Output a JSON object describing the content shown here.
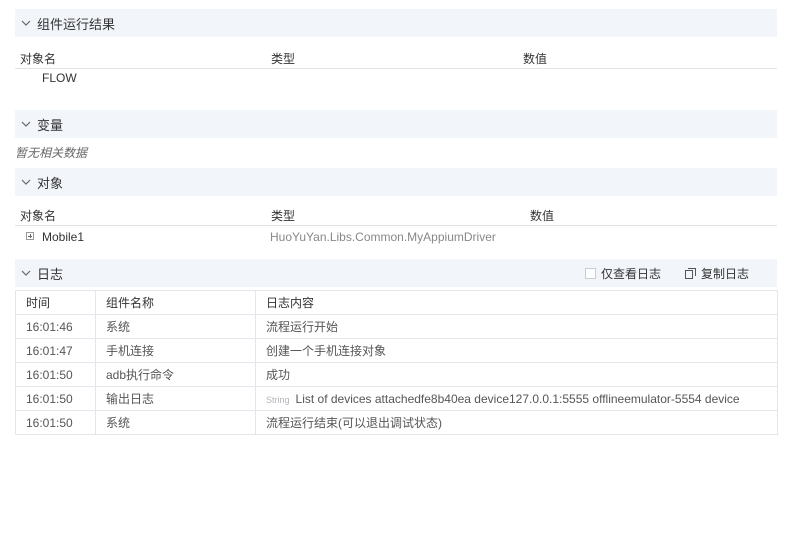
{
  "sections": {
    "results": {
      "title": "组件运行结果",
      "columns": [
        "对象名",
        "类型",
        "数值"
      ],
      "rows": [
        {
          "name": "FLOW",
          "type": "",
          "value": ""
        }
      ]
    },
    "variables": {
      "title": "变量",
      "empty_text": "暂无相关数据"
    },
    "objects": {
      "title": "对象",
      "columns": [
        "对象名",
        "类型",
        "数值"
      ],
      "rows": [
        {
          "name": "Mobile1",
          "type": "HuoYuYan.Libs.Common.MyAppiumDriver",
          "value": ""
        }
      ]
    },
    "log": {
      "title": "日志",
      "only_view_log_label": "仅查看日志",
      "copy_log_label": "复制日志",
      "columns": [
        "时间",
        "组件名称",
        "日志内容"
      ],
      "rows": [
        {
          "time": "16:01:46",
          "component": "系统",
          "content": "流程运行开始",
          "tag": ""
        },
        {
          "time": "16:01:47",
          "component": "手机连接",
          "content": "创建一个手机连接对象",
          "tag": ""
        },
        {
          "time": "16:01:50",
          "component": "adb执行命令",
          "content": "成功",
          "tag": ""
        },
        {
          "time": "16:01:50",
          "component": "输出日志",
          "content": "List of devices attachedfe8b40ea device127.0.0.1:5555 offlineemulator-5554 device",
          "tag": "String"
        },
        {
          "time": "16:01:50",
          "component": "系统",
          "content": "流程运行结束(可以退出调试状态)",
          "tag": ""
        }
      ]
    }
  },
  "icons": [
    "chevron-down-icon",
    "plus-box-icon",
    "checkbox-icon",
    "copy-icon"
  ],
  "colors": {
    "section_bg": "#f2f5fa",
    "border": "#e3e6ea",
    "muted_text": "#888888"
  }
}
